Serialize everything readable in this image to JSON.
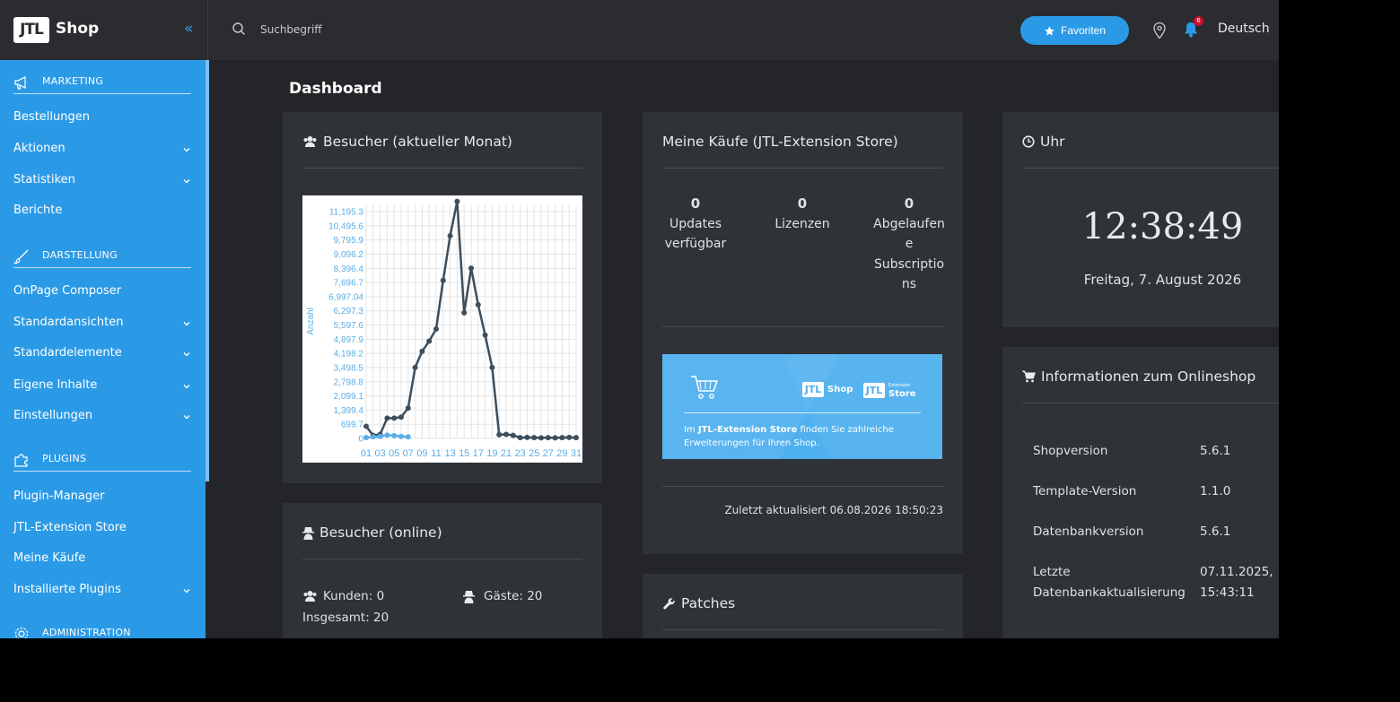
{
  "brand": {
    "logo": "JTL",
    "name": "Shop",
    "collapse": "«"
  },
  "search": {
    "placeholder": "Suchbegriff"
  },
  "header": {
    "favorites_label": "Favoriten",
    "notification_count": "6",
    "language": "Deutsch"
  },
  "sidebar": {
    "sections": [
      {
        "title": "MARKETING",
        "icon": "megaphone-icon"
      },
      {
        "title": "DARSTELLUNG",
        "icon": "brush-icon"
      },
      {
        "title": "PLUGINS",
        "icon": "puzzle-icon"
      },
      {
        "title": "ADMINISTRATION",
        "icon": "gear-icon"
      }
    ],
    "items": [
      {
        "label": "Bestellungen",
        "expandable": false
      },
      {
        "label": "Aktionen",
        "expandable": true
      },
      {
        "label": "Statistiken",
        "expandable": true
      },
      {
        "label": "Berichte",
        "expandable": false
      },
      {
        "label": "OnPage Composer",
        "expandable": false
      },
      {
        "label": "Standardansichten",
        "expandable": true
      },
      {
        "label": "Standardelemente",
        "expandable": true
      },
      {
        "label": "Eigene Inhalte",
        "expandable": true
      },
      {
        "label": "Einstellungen",
        "expandable": true
      },
      {
        "label": "Plugin-Manager",
        "expandable": false
      },
      {
        "label": "JTL-Extension Store",
        "expandable": false
      },
      {
        "label": "Meine Käufe",
        "expandable": false
      },
      {
        "label": "Installierte Plugins",
        "expandable": true
      }
    ]
  },
  "page": {
    "title": "Dashboard"
  },
  "visitors_card": {
    "title": "Besucher (aktueller Monat)"
  },
  "purchases_card": {
    "title": "Meine Käufe (JTL-Extension Store)",
    "stats": [
      {
        "value": "0",
        "label_lines": [
          "Updates",
          "verfügbar"
        ]
      },
      {
        "value": "0",
        "label_lines": [
          "Lizenzen"
        ]
      },
      {
        "value": "0",
        "label_lines": [
          "Abgelaufen",
          "e",
          "Subscriptio",
          "ns"
        ]
      }
    ],
    "banner": {
      "logo1": "Shop",
      "logo2": "Store",
      "logo2_small": "Extension",
      "text_bold": "JTL-Extension Store",
      "text_pre": "Im ",
      "text_post": " finden Sie zahlreiche Erweiterungen für Ihren Shop."
    },
    "updated": "Zuletzt aktualisiert 06.08.2026 18:50:23"
  },
  "clock_card": {
    "title": "Uhr",
    "time": "12:38:49",
    "date": "Freitag, 7. August 2026"
  },
  "shopinfo_card": {
    "title": "Informationen zum Onlineshop",
    "rows": [
      {
        "label": "Shopversion",
        "value": "5.6.1"
      },
      {
        "label": "Template-Version",
        "value": "1.1.0"
      },
      {
        "label": "Datenbankversion",
        "value": "5.6.1"
      },
      {
        "label": "Letzte Datenbankaktualisierung",
        "value": "07.11.2025, 15:43:11"
      }
    ]
  },
  "online_card": {
    "title": "Besucher (online)",
    "customers": "Kunden: 0",
    "guests": "Gäste: 20",
    "total": "Insgesamt: 20"
  },
  "patches_card": {
    "title": "Patches"
  },
  "chart_data": {
    "type": "line",
    "title": "",
    "xlabel": "",
    "ylabel": "Anzahl",
    "ylim": [
      0,
      11195.3
    ],
    "y_ticks": [
      "0",
      "699.7",
      "1,399.4",
      "2,099.1",
      "2,798.8",
      "3,498.5",
      "4,198.2",
      "4,897.9",
      "5,597.6",
      "6,297.3",
      "6,997.04",
      "7,696.7",
      "8,396.4",
      "9,096.2",
      "9,795.9",
      "10,495.6",
      "11,195.3"
    ],
    "x_ticks": [
      "01",
      "03",
      "05",
      "07",
      "09",
      "11",
      "13",
      "15",
      "17",
      "19",
      "21",
      "23",
      "25",
      "27",
      "29",
      "31"
    ],
    "grid": true,
    "series": [
      {
        "color": "#3d4e5c",
        "x": [
          1,
          2,
          3,
          4,
          5,
          6,
          7,
          8,
          9,
          10,
          11,
          12,
          13,
          14,
          15,
          16,
          17,
          18,
          19,
          20,
          21,
          22,
          23,
          24,
          25,
          26,
          27,
          28,
          29,
          30,
          31
        ],
        "values": [
          600,
          150,
          200,
          1000,
          1000,
          1050,
          1500,
          3500,
          4300,
          4800,
          5400,
          7800,
          10000,
          11700,
          6200,
          8400,
          6600,
          5100,
          3500,
          180,
          200,
          150,
          40,
          50,
          40,
          30,
          40,
          30,
          40,
          50,
          40
        ]
      },
      {
        "color": "#5aaee6",
        "x": [
          1,
          2,
          3,
          4,
          5,
          6,
          7
        ],
        "values": [
          40,
          80,
          100,
          160,
          140,
          100,
          80
        ]
      }
    ]
  }
}
